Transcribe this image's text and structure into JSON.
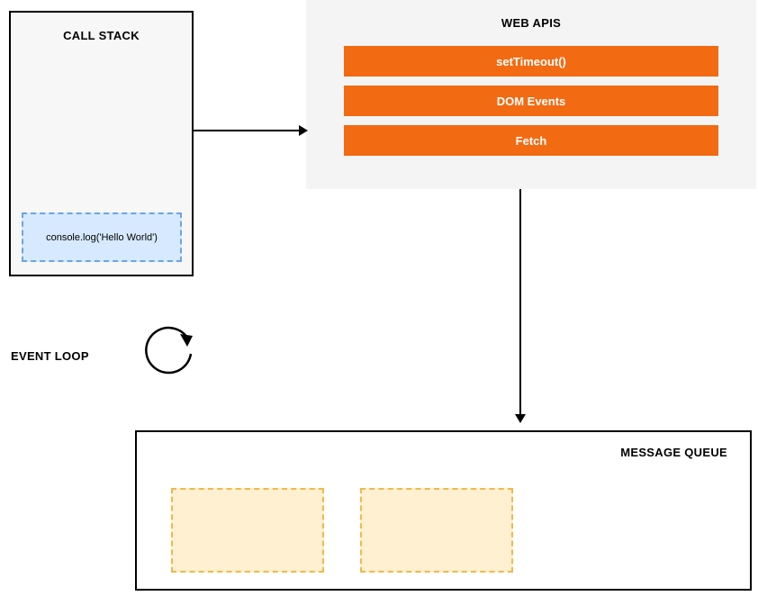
{
  "call_stack": {
    "title": "CALL STACK",
    "item": "console.log('Hello World')"
  },
  "web_apis": {
    "title": "WEB APIS",
    "items": [
      "setTimeout()",
      "DOM Events",
      "Fetch"
    ]
  },
  "event_loop": {
    "label": "EVENT LOOP"
  },
  "message_queue": {
    "title": "MESSAGE QUEUE",
    "item_count": 2
  }
}
